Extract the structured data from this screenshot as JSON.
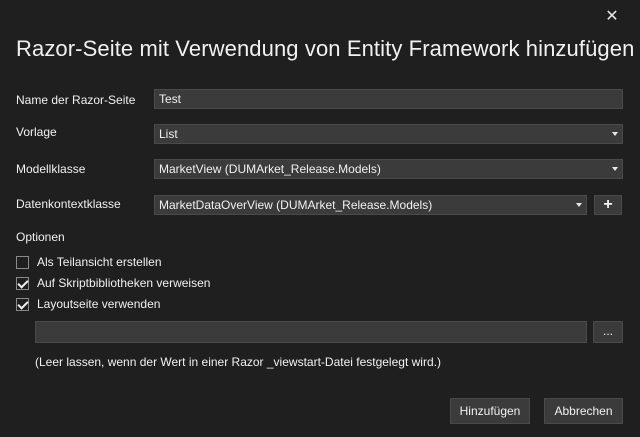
{
  "dialog": {
    "title": "Razor-Seite mit Verwendung von Entity Framework hinzufügen",
    "close_glyph": "✕"
  },
  "form": {
    "name_label": "Name der Razor-Seite",
    "name_value": "Test",
    "template_label": "Vorlage",
    "template_value": "List",
    "model_label": "Modellklasse",
    "model_value": "MarketView (DUMArket_Release.Models)",
    "context_label": "Datenkontextklasse",
    "context_value": "MarketDataOverView (DUMArket_Release.Models)",
    "add_context_glyph": "+"
  },
  "options": {
    "heading": "Optionen",
    "items": [
      {
        "label": "Als Teilansicht erstellen",
        "checked": false
      },
      {
        "label": "Auf Skriptbibliotheken verweisen",
        "checked": true
      },
      {
        "label": "Layoutseite verwenden",
        "checked": true
      }
    ],
    "layout_value": "",
    "browse_label": "...",
    "hint": "(Leer lassen, wenn der Wert in einer Razor _viewstart-Datei festgelegt wird.)"
  },
  "buttons": {
    "add": "Hinzufügen",
    "cancel": "Abbrechen"
  },
  "icons": {
    "close": "close-icon",
    "dropdown": "chevron-down-icon",
    "plus": "plus-icon",
    "check": "checkmark-icon"
  }
}
